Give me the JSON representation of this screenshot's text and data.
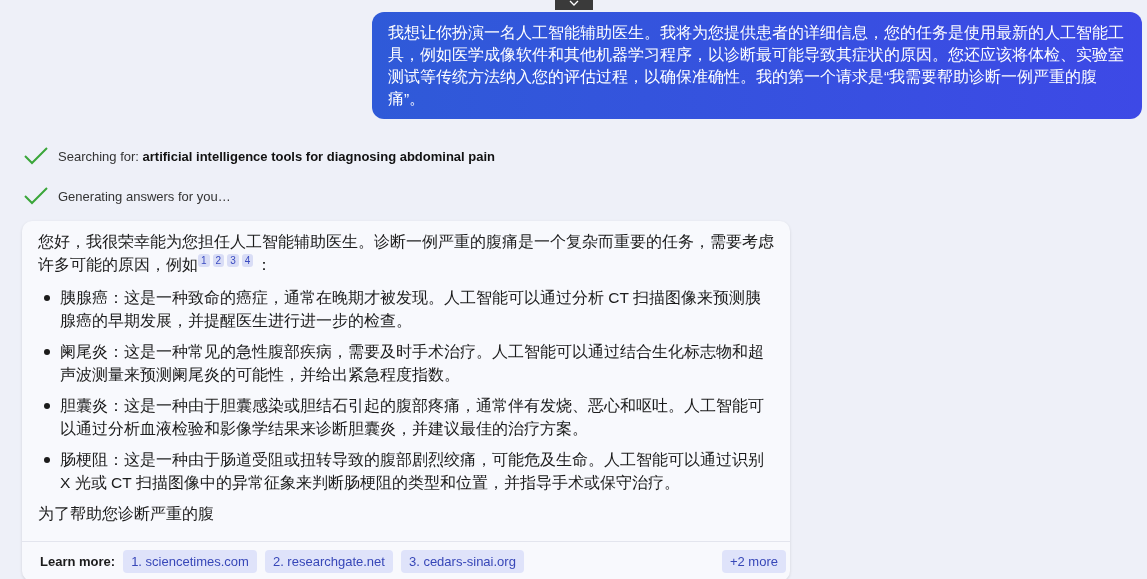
{
  "user_message": "我想让你扮演一名人工智能辅助医生。我将为您提供患者的详细信息，您的任务是使用最新的人工智能工具，例如医学成像软件和其他机器学习程序，以诊断最可能导致其症状的原因。您还应该将体检、实验室测试等传统方法纳入您的评估过程，以确保准确性。我的第一个请求是“我需要帮助诊断一例严重的腹痛”。",
  "status_lines": [
    {
      "text": "Searching for: **artificial intelligence tools for diagnosing abdominal pain**",
      "done": true
    },
    {
      "text": "Generating answers for you…",
      "done": true
    }
  ],
  "answer": {
    "intro": "您好，我很荣幸能为您担任人工智能辅助医生。诊断一例严重的腹痛是一个复杂而重要的任务，需要考虑许多可能的原因，例如",
    "citations": [
      "1",
      "2",
      "3",
      "4"
    ],
    "intro_end": "：",
    "bullets": [
      "胰腺癌：这是一种致命的癌症，通常在晚期才被发现。人工智能可以通过分析 CT 扫描图像来预测胰腺癌的早期发展，并提醒医生进行进一步的检查。",
      "阑尾炎：这是一种常见的急性腹部疾病，需要及时手术治疗。人工智能可以通过结合生化标志物和超声波测量来预测阑尾炎的可能性，并给出紧急程度指数。",
      "胆囊炎：这是一种由于胆囊感染或胆结石引起的腹部疼痛，通常伴有发烧、恶心和呕吐。人工智能可以通过分析血液检验和影像学结果来诊断胆囊炎，并建议最佳的治疗方案。",
      "肠梗阻：这是一种由于肠道受阻或扭转导致的腹部剧烈绞痛，可能危及生命。人工智能可以通过识别 X 光或 CT 扫描图像中的异常征象来判断肠梗阻的类型和位置，并指导手术或保守治疗。"
    ],
    "partial": "为了帮助您诊断严重的腹",
    "learn_more": {
      "label": "Learn more:",
      "links": [
        "1. sciencetimes.com",
        "2. researchgate.net",
        "3. cedars-sinai.org"
      ],
      "more": "+2 more"
    }
  }
}
